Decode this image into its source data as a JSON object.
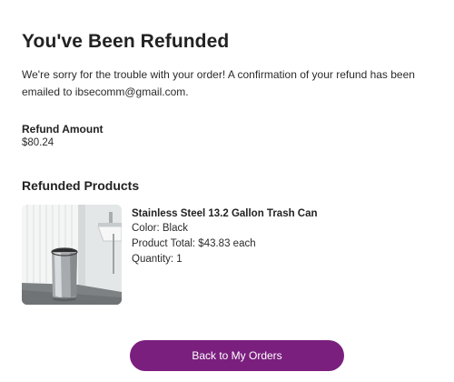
{
  "header": {
    "title": "You've Been Refunded"
  },
  "message": "We're sorry for the trouble with your order! A confirmation of your refund has been emailed to ibsecomm@gmail.com.",
  "refund": {
    "label": "Refund Amount",
    "value": "$80.24"
  },
  "refunded_products": {
    "title": "Refunded Products",
    "items": [
      {
        "name": "Stainless Steel 13.2 Gallon Trash Can",
        "color": "Color: Black",
        "product_total": "Product Total: $43.83 each",
        "quantity": "Quantity: 1"
      }
    ]
  },
  "actions": {
    "back_label": "Back to My Orders"
  },
  "colors": {
    "accent": "#7b1f7f"
  }
}
